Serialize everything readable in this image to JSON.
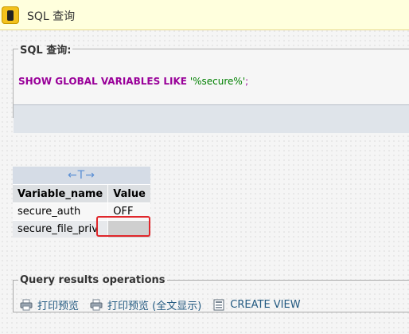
{
  "banner": {
    "title": "SQL 查询",
    "icon": "warning-icon"
  },
  "sql_box": {
    "legend": "SQL 查询:",
    "query": {
      "keyword": "SHOW GLOBAL VARIABLES LIKE",
      "pattern": "'%secure%'",
      "separator": ";"
    }
  },
  "results": {
    "toggle_symbol": "←T→",
    "columns": [
      "Variable_name",
      "Value"
    ],
    "rows": [
      {
        "name": "secure_auth",
        "value": "OFF"
      },
      {
        "name": "secure_file_priv",
        "value": ""
      }
    ]
  },
  "operations": {
    "legend": "Query results operations",
    "actions": [
      {
        "label": "打印预览",
        "icon": "print-icon"
      },
      {
        "label": "打印预览 (全文显示)",
        "icon": "print-icon"
      },
      {
        "label": "CREATE VIEW",
        "icon": "view-icon"
      }
    ]
  },
  "colors": {
    "keyword": "#990099",
    "string": "#008000",
    "link": "#235a81",
    "highlight": "#e0272b"
  }
}
